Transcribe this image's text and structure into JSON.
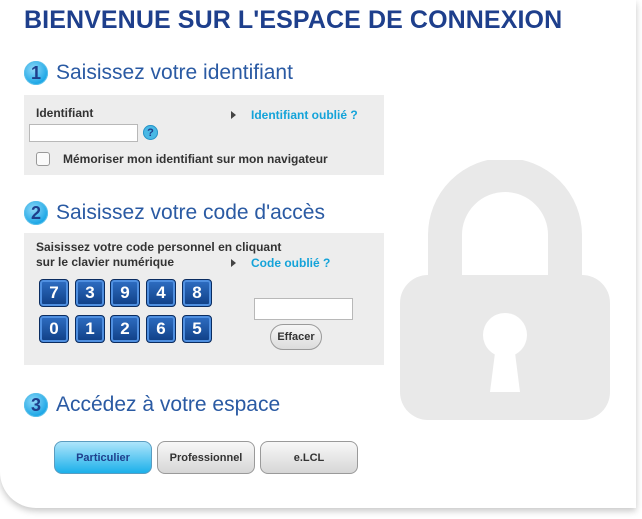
{
  "header": {
    "title": "BIENVENUE SUR L'ESPACE DE CONNEXION"
  },
  "step1": {
    "number": "1",
    "title": "Saisissez votre identifiant",
    "field_label": "Identifiant",
    "field_value": "",
    "help_glyph": "?",
    "forgot_link": "Identifiant oublié ?",
    "remember_label": "Mémoriser mon identifiant sur mon navigateur",
    "remember_checked": false
  },
  "step2": {
    "number": "2",
    "title": "Saisissez votre code d'accès",
    "instruction_line1": "Saisissez votre code personnel en cliquant",
    "instruction_line2": "sur le clavier numérique",
    "forgot_link": "Code oublié ?",
    "keypad_row1": [
      "7",
      "3",
      "9",
      "4",
      "8"
    ],
    "keypad_row2": [
      "0",
      "1",
      "2",
      "6",
      "5"
    ],
    "code_value": "",
    "clear_button": "Effacer"
  },
  "step3": {
    "number": "3",
    "title": "Accédez à votre espace",
    "tabs": [
      {
        "label": "Particulier",
        "active": true
      },
      {
        "label": "Professionnel",
        "active": false
      },
      {
        "label": "e.LCL",
        "active": false
      }
    ]
  },
  "colors": {
    "title": "#1e3f8c",
    "step_title": "#2a5aa3",
    "link": "#14a3d9",
    "panel_bg": "#ededed",
    "key_bg": "#1a4f9e",
    "active_tab": "#1cb0ea"
  },
  "icons": {
    "background": "padlock-icon",
    "help": "question-mark-icon",
    "link_bullet": "triangle-right-icon"
  }
}
